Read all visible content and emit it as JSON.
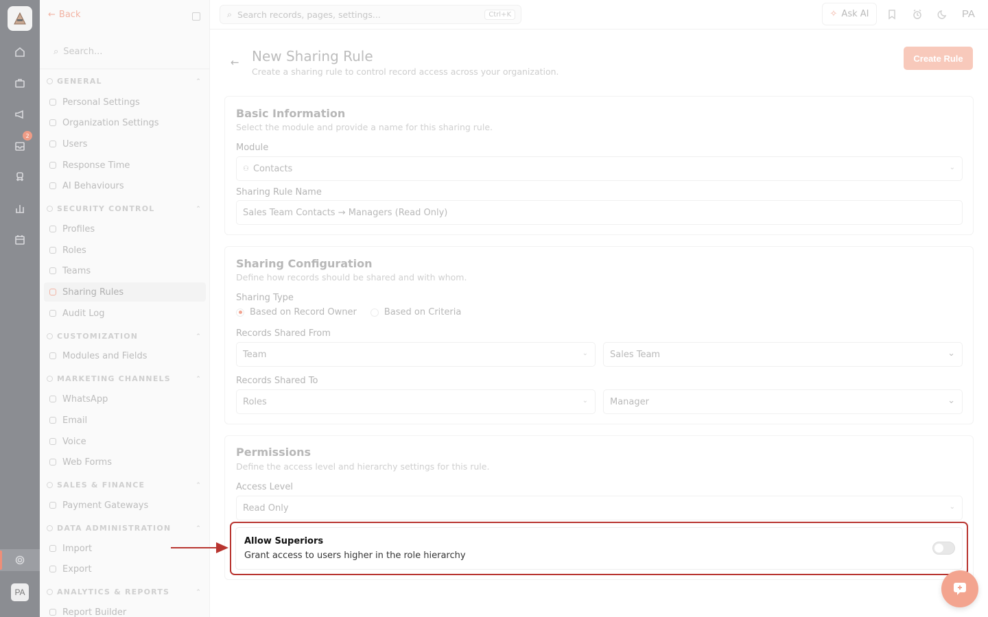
{
  "rail": {
    "badge": "2",
    "avatar": "PA"
  },
  "sidebar": {
    "back_label": "Back",
    "search_placeholder": "Search...",
    "sections": [
      {
        "title": "GENERAL",
        "items": [
          "Personal Settings",
          "Organization Settings",
          "Users",
          "Response Time",
          "AI Behaviours"
        ]
      },
      {
        "title": "SECURITY CONTROL",
        "items": [
          "Profiles",
          "Roles",
          "Teams",
          "Sharing Rules",
          "Audit Log"
        ]
      },
      {
        "title": "CUSTOMIZATION",
        "items": [
          "Modules and Fields"
        ]
      },
      {
        "title": "MARKETING CHANNELS",
        "items": [
          "WhatsApp",
          "Email",
          "Voice",
          "Web Forms"
        ]
      },
      {
        "title": "SALES & FINANCE",
        "items": [
          "Payment Gateways"
        ]
      },
      {
        "title": "DATA ADMINISTRATION",
        "items": [
          "Import",
          "Export"
        ]
      },
      {
        "title": "ANALYTICS & REPORTS",
        "items": [
          "Report Builder"
        ]
      }
    ]
  },
  "topbar": {
    "search_placeholder": "Search records, pages, settings...",
    "shortcut": "Ctrl+K",
    "ask_ai": "Ask AI",
    "user_initials": "PA"
  },
  "page": {
    "title": "New Sharing Rule",
    "subtitle": "Create a sharing rule to control record access across your organization.",
    "create_button": "Create Rule"
  },
  "basic": {
    "title": "Basic Information",
    "subtitle": "Select the module and provide a name for this sharing rule.",
    "module_label": "Module",
    "module_value": "Contacts",
    "name_label": "Sharing Rule Name",
    "name_value": "Sales Team Contacts → Managers (Read Only)"
  },
  "config": {
    "title": "Sharing Configuration",
    "subtitle": "Define how records should be shared and with whom.",
    "type_label": "Sharing Type",
    "type_options": [
      "Based on Record Owner",
      "Based on Criteria"
    ],
    "type_selected": "Based on Record Owner",
    "from_label": "Records Shared From",
    "from_type": "Team",
    "from_value": "Sales Team",
    "to_label": "Records Shared To",
    "to_type": "Roles",
    "to_value": "Manager"
  },
  "permissions": {
    "title": "Permissions",
    "subtitle": "Define the access level and hierarchy settings for this rule.",
    "access_label": "Access Level",
    "access_value": "Read Only",
    "superiors_title": "Allow Superiors",
    "superiors_desc": "Grant access to users higher in the role hierarchy",
    "superiors_enabled": false
  }
}
